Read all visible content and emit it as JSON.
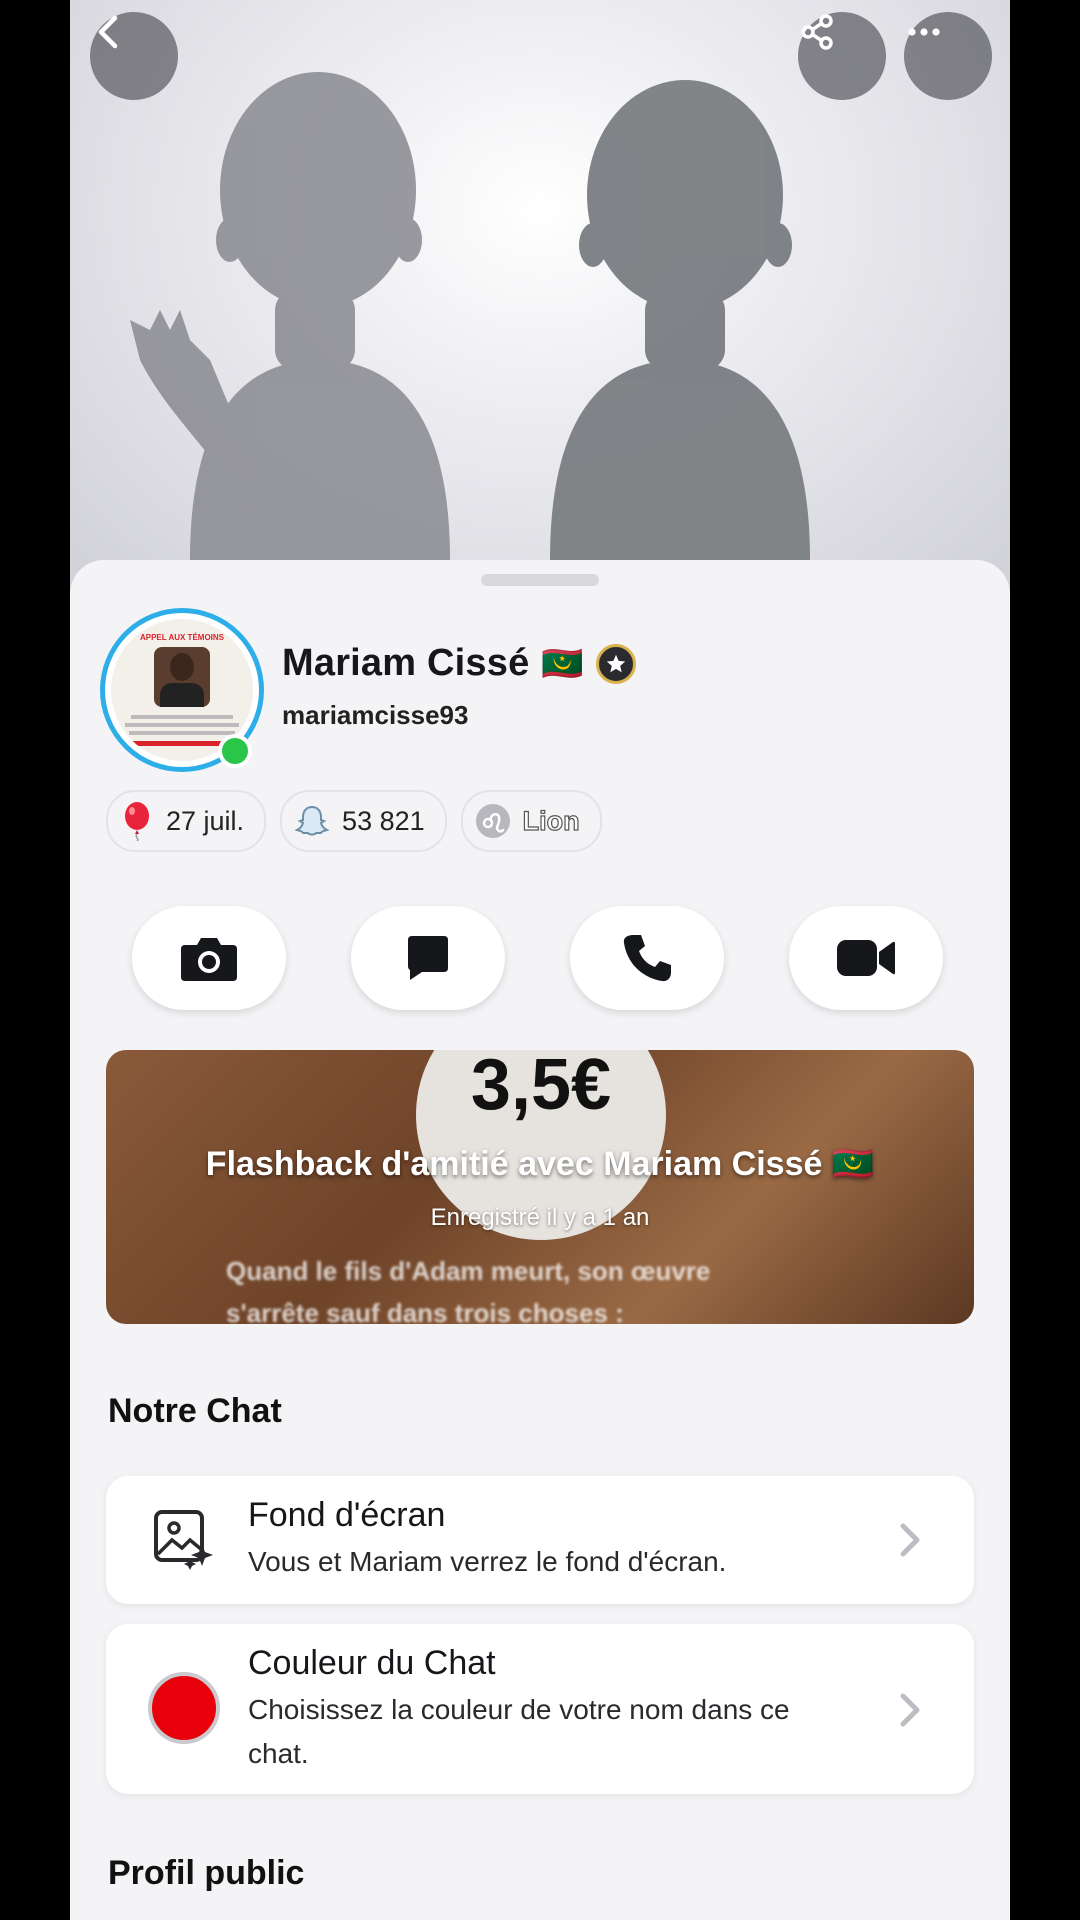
{
  "header": {
    "back_label": "Retour",
    "share_label": "Partager",
    "more_label": "Plus"
  },
  "profile": {
    "display_name": "Mariam Cissé",
    "flag_emoji": "🇲🇷",
    "username": "mariamcisse93",
    "online": true,
    "avatar_caption_lines": [
      "APPEL AUX TÉMOINS"
    ]
  },
  "chips": [
    {
      "icon": "balloon-icon",
      "label": "27 juil."
    },
    {
      "icon": "snap-score-icon",
      "label": "53 821"
    },
    {
      "icon": "zodiac-leo-icon",
      "label": "Lion"
    }
  ],
  "actions": [
    {
      "icon": "camera-icon"
    },
    {
      "icon": "chat-icon"
    },
    {
      "icon": "phone-icon"
    },
    {
      "icon": "video-icon"
    }
  ],
  "flashback": {
    "price_text": "3,5€",
    "title": "Flashback d'amitié avec Mariam Cissé 🇲🇷",
    "subtitle": "Enregistré il y a 1 an",
    "line1": "Quand le fils d'Adam meurt, son œuvre",
    "line2": "s'arrête sauf dans trois choses :"
  },
  "our_chat": {
    "section_title": "Notre Chat",
    "wallpaper": {
      "title": "Fond d'écran",
      "subtitle": "Vous et Mariam verrez le fond d'écran."
    },
    "chat_color": {
      "title": "Couleur du Chat",
      "subtitle": "Choisissez la couleur de votre nom dans ce chat.",
      "color": "#e8000a"
    }
  },
  "public_profile": {
    "section_title": "Profil public"
  },
  "colors": {
    "ring": "#2eaee8",
    "online": "#29c64a",
    "background": "#f4f4f6"
  }
}
